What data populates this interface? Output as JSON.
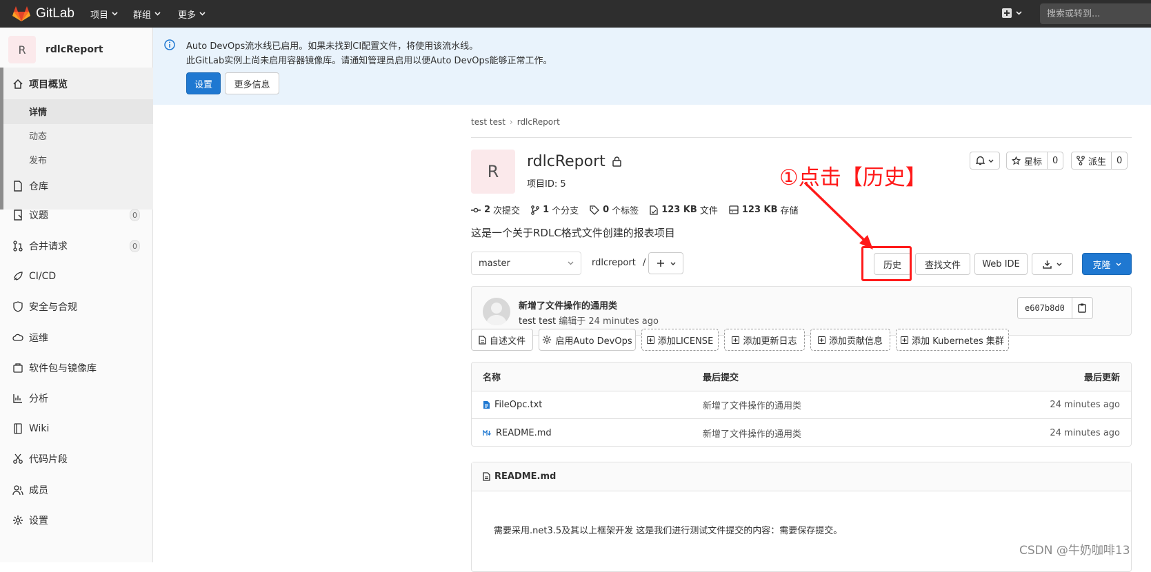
{
  "navbar": {
    "brand": "GitLab",
    "menus": [
      "项目",
      "群组",
      "更多"
    ],
    "search_placeholder": "搜索或转到..."
  },
  "sidebar": {
    "avatar_letter": "R",
    "project_name": "rdlcReport",
    "overview": {
      "label": "项目概览",
      "subitems": [
        "详情",
        "动态",
        "发布"
      ]
    },
    "items": [
      {
        "label": "仓库"
      },
      {
        "label": "议题",
        "count": "0"
      },
      {
        "label": "合并请求",
        "count": "0"
      },
      {
        "label": "CI/CD"
      },
      {
        "label": "安全与合规"
      },
      {
        "label": "运维"
      },
      {
        "label": "软件包与镜像库"
      },
      {
        "label": "分析"
      },
      {
        "label": "Wiki"
      },
      {
        "label": "代码片段"
      },
      {
        "label": "成员"
      },
      {
        "label": "设置"
      }
    ]
  },
  "banner": {
    "line1": "Auto DevOps流水线已启用。如果未找到CI配置文件，将使用该流水线。",
    "line2": "此GitLab实例上尚未启用容器镜像库。请通知管理员启用以便Auto DevOps能够正常工作。",
    "settings_button": "设置",
    "more_info_button": "更多信息"
  },
  "breadcrumb": [
    "test test",
    "rdlcReport"
  ],
  "project": {
    "avatar_letter": "R",
    "name": "rdlcReport",
    "id_label": "项目ID: 5",
    "star_label": "星标",
    "star_count": "0",
    "fork_label": "派生",
    "fork_count": "0",
    "stats": [
      {
        "value": "2",
        "label": "次提交",
        "icon": "commit-icon"
      },
      {
        "value": "1",
        "label": "个分支",
        "icon": "branch-icon"
      },
      {
        "value": "0",
        "label": "个标签",
        "icon": "tag-icon"
      },
      {
        "value": "123 KB",
        "label": "文件",
        "icon": "file-icon"
      },
      {
        "value": "123 KB",
        "label": "存储",
        "icon": "storage-icon"
      }
    ],
    "description": "这是一个关于RDLC格式文件创建的报表项目"
  },
  "repo_toolbar": {
    "branch": "master",
    "path": "rdlcreport",
    "path_sep": "/",
    "history_button": "历史",
    "find_file_button": "查找文件",
    "web_ide_button": "Web IDE",
    "clone_button": "克隆"
  },
  "last_commit": {
    "title": "新增了文件操作的通用类",
    "author": "test test",
    "edited_label": "编辑于",
    "time": "24 minutes ago",
    "sha": "e607b8d0"
  },
  "action_buttons": {
    "readme": "自述文件",
    "auto_devops": "启用Auto DevOps",
    "license": "添加LICENSE",
    "changelog": "添加更新日志",
    "contributing": "添加贡献信息",
    "kubernetes": "添加 Kubernetes 集群"
  },
  "file_table": {
    "headers": [
      "名称",
      "最后提交",
      "最后更新"
    ],
    "rows": [
      {
        "name": "FileOpc.txt",
        "commit": "新增了文件操作的通用类",
        "updated": "24 minutes ago"
      },
      {
        "name": "README.md",
        "commit": "新增了文件操作的通用类",
        "updated": "24 minutes ago"
      }
    ]
  },
  "readme": {
    "filename": "README.md",
    "content": "需要采用.net3.5及其以上框架开发 这是我们进行测试文件提交的内容：需要保存提交。"
  },
  "annotation": {
    "text": "①点击【历史】",
    "color": "#ff1a1a"
  },
  "watermark": "CSDN @牛奶咖啡13",
  "colors": {
    "primary": "#1f78d1",
    "navbar": "#2e2e2e",
    "banner": "#e9f3fc",
    "annotation": "#ff1a1a"
  }
}
